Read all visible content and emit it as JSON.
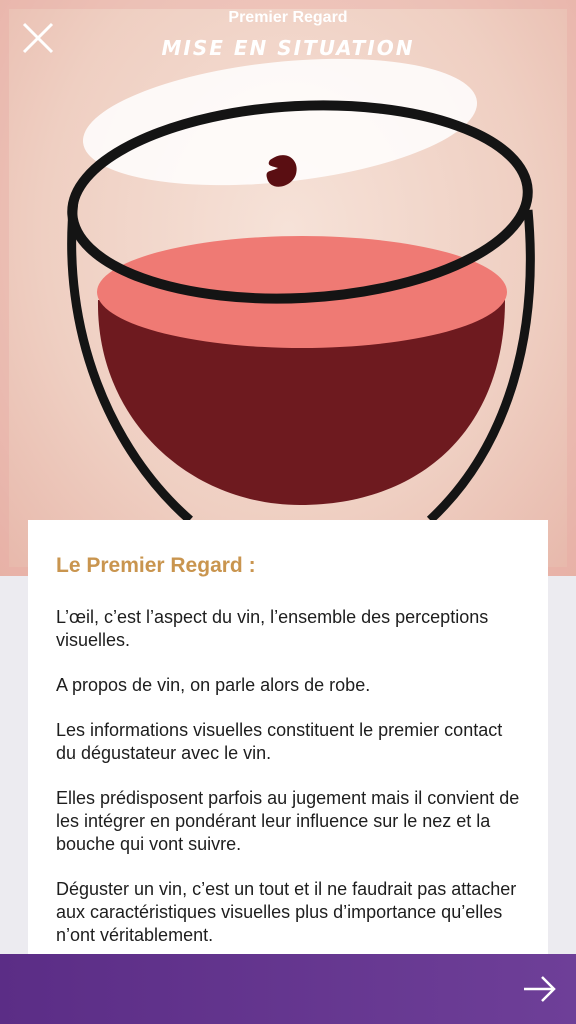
{
  "header": {
    "title": "Premier Regard",
    "subtitle": "MISE EN SITUATION",
    "close_icon": "close-icon"
  },
  "card": {
    "title": "Le Premier Regard :",
    "paragraphs": [
      "L’œil, c’est l’aspect du vin, l’ensemble des perceptions visuelles.",
      "A propos de vin, on parle alors de robe.",
      "Les informations visuelles constituent le premier contact du dégustateur avec le vin.",
      "Elles prédisposent parfois au jugement mais il convient de les intégrer en pondérant leur influence sur le nez et la bouche qui vont suivre.",
      "Déguster un vin, c’est un tout et il ne faudrait pas attacher aux caractéristiques visuelles plus d’importance qu’elles n’ont véritablement."
    ]
  },
  "footer": {
    "next_icon": "arrow-right-icon"
  },
  "colors": {
    "accent": "#c9954f",
    "bar": "#5b2d86",
    "wine_surface": "#ef7a74",
    "wine_body": "#6e1a1f"
  }
}
